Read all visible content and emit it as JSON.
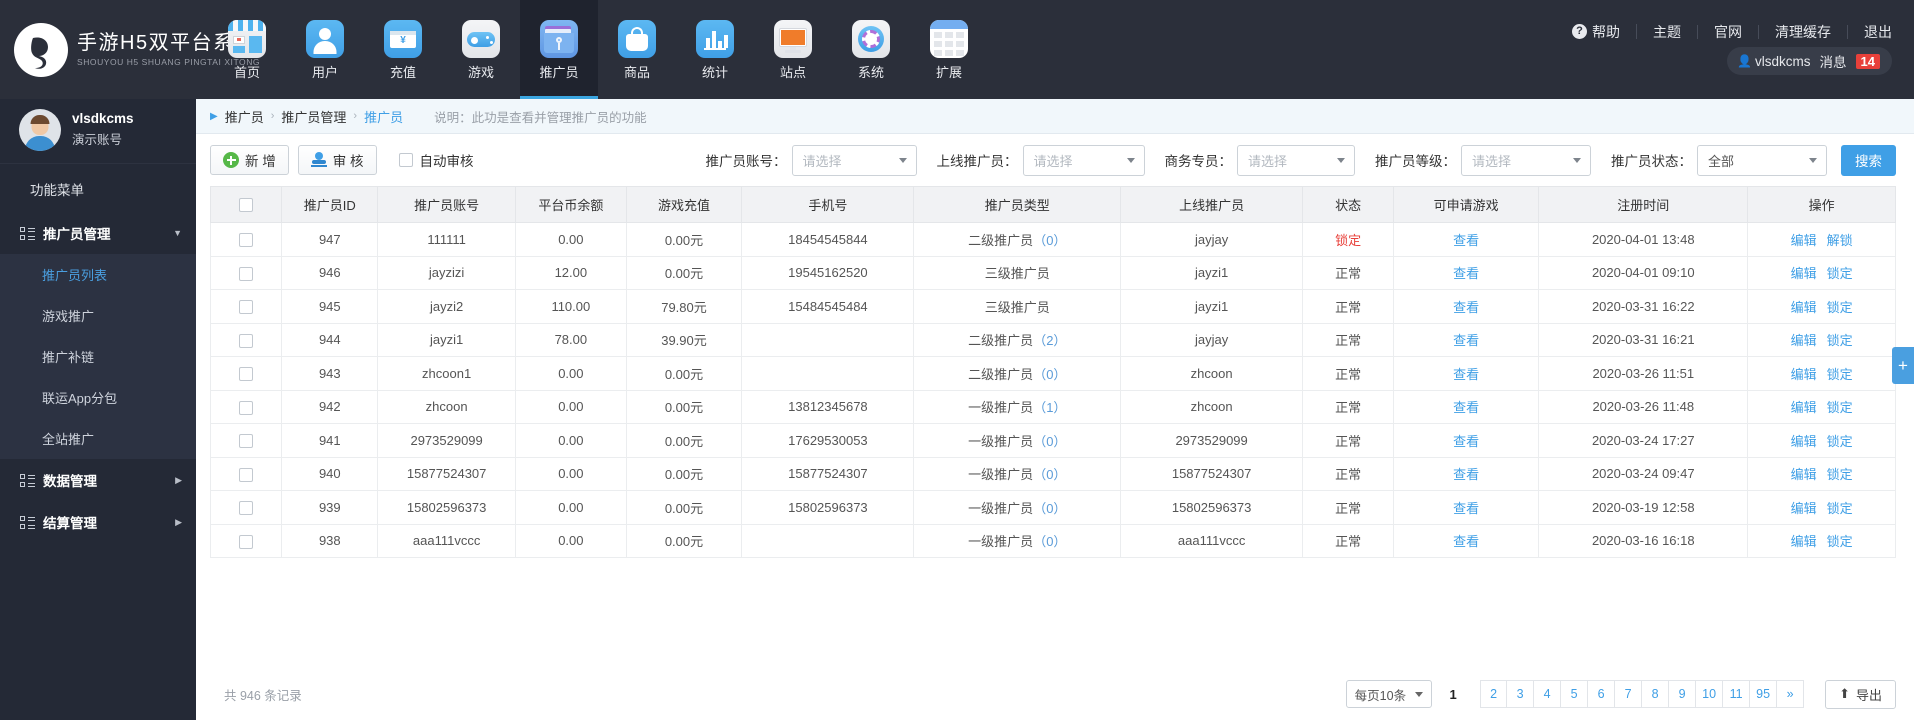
{
  "brand": {
    "cn": "手游H5双平台系统",
    "en": "SHOUYOU H5 SHUANG PINGTAI XITONG"
  },
  "topnav": [
    {
      "label": "首页",
      "icon": "storefront-icon",
      "active": false
    },
    {
      "label": "用户",
      "icon": "user-icon",
      "active": false
    },
    {
      "label": "充值",
      "icon": "payment-card-icon",
      "active": false
    },
    {
      "label": "游戏",
      "icon": "gamepad-icon",
      "active": false
    },
    {
      "label": "推广员",
      "icon": "folder-promo-icon",
      "active": true
    },
    {
      "label": "商品",
      "icon": "shopping-bag-icon",
      "active": false
    },
    {
      "label": "统计",
      "icon": "bar-chart-icon",
      "active": false
    },
    {
      "label": "站点",
      "icon": "monitor-icon",
      "active": false
    },
    {
      "label": "系统",
      "icon": "gear-icon",
      "active": false
    },
    {
      "label": "扩展",
      "icon": "grid-calendar-icon",
      "active": false
    }
  ],
  "topright": {
    "links": [
      "帮助",
      "主题",
      "官网",
      "清理缓存",
      "退出"
    ],
    "username": "vlsdkcms",
    "message_label": "消息",
    "message_count": "14"
  },
  "sidebar": {
    "username": "vlsdkcms",
    "role": "演示账号",
    "menu_title": "功能菜单",
    "groups": [
      {
        "label": "推广员管理",
        "expanded": true,
        "items": [
          {
            "label": "推广员列表",
            "active": true
          },
          {
            "label": "游戏推广",
            "active": false
          },
          {
            "label": "推广补链",
            "active": false
          },
          {
            "label": "联运App分包",
            "active": false
          },
          {
            "label": "全站推广",
            "active": false
          }
        ]
      },
      {
        "label": "数据管理",
        "expanded": false,
        "items": []
      },
      {
        "label": "结算管理",
        "expanded": false,
        "items": []
      }
    ]
  },
  "breadcrumb": {
    "items": [
      "推广员",
      "推广员管理",
      "推广员"
    ],
    "description": "说明：此功是查看并管理推广员的功能"
  },
  "toolbar": {
    "new_label": "新 增",
    "audit_label": "审 核",
    "auto_audit_label": "自动审核",
    "auto_audit_checked": false,
    "search_label": "搜索",
    "filters": [
      {
        "label": "推广员账号：",
        "value": "请选择"
      },
      {
        "label": "上线推广员：",
        "value": "请选择"
      },
      {
        "label": "商务专员：",
        "value": "请选择"
      },
      {
        "label": "推广员等级：",
        "value": "请选择"
      },
      {
        "label": "推广员状态：",
        "value": "全部"
      }
    ]
  },
  "table": {
    "columns": [
      "推广员ID",
      "推广员账号",
      "平台币余额",
      "游戏充值",
      "手机号",
      "推广员类型",
      "上线推广员",
      "状态",
      "可申请游戏",
      "注册时间",
      "操作"
    ],
    "view_label": "查看",
    "rows": [
      {
        "id": "947",
        "account": "111111",
        "balance": "0.00",
        "recharge": "0.00元",
        "phone": "18454545844",
        "type": "二级推广员",
        "count": "0",
        "upline": "jayjay",
        "status": "锁定",
        "status_locked": true,
        "time": "2020-04-01 13:48",
        "ops": [
          "编辑",
          "解锁"
        ]
      },
      {
        "id": "946",
        "account": "jayzizi",
        "balance": "12.00",
        "recharge": "0.00元",
        "phone": "19545162520",
        "type": "三级推广员",
        "count": "",
        "upline": "jayzi1",
        "status": "正常",
        "status_locked": false,
        "time": "2020-04-01 09:10",
        "ops": [
          "编辑",
          "锁定"
        ]
      },
      {
        "id": "945",
        "account": "jayzi2",
        "balance": "110.00",
        "recharge": "79.80元",
        "phone": "15484545484",
        "type": "三级推广员",
        "count": "",
        "upline": "jayzi1",
        "status": "正常",
        "status_locked": false,
        "time": "2020-03-31 16:22",
        "ops": [
          "编辑",
          "锁定"
        ]
      },
      {
        "id": "944",
        "account": "jayzi1",
        "balance": "78.00",
        "recharge": "39.90元",
        "phone": "",
        "type": "二级推广员",
        "count": "2",
        "upline": "jayjay",
        "status": "正常",
        "status_locked": false,
        "time": "2020-03-31 16:21",
        "ops": [
          "编辑",
          "锁定"
        ]
      },
      {
        "id": "943",
        "account": "zhcoon1",
        "balance": "0.00",
        "recharge": "0.00元",
        "phone": "",
        "type": "二级推广员",
        "count": "0",
        "upline": "zhcoon",
        "status": "正常",
        "status_locked": false,
        "time": "2020-03-26 11:51",
        "ops": [
          "编辑",
          "锁定"
        ]
      },
      {
        "id": "942",
        "account": "zhcoon",
        "balance": "0.00",
        "recharge": "0.00元",
        "phone": "13812345678",
        "type": "一级推广员",
        "count": "1",
        "upline": "zhcoon",
        "status": "正常",
        "status_locked": false,
        "time": "2020-03-26 11:48",
        "ops": [
          "编辑",
          "锁定"
        ]
      },
      {
        "id": "941",
        "account": "2973529099",
        "balance": "0.00",
        "recharge": "0.00元",
        "phone": "17629530053",
        "type": "一级推广员",
        "count": "0",
        "upline": "2973529099",
        "status": "正常",
        "status_locked": false,
        "time": "2020-03-24 17:27",
        "ops": [
          "编辑",
          "锁定"
        ]
      },
      {
        "id": "940",
        "account": "15877524307",
        "balance": "0.00",
        "recharge": "0.00元",
        "phone": "15877524307",
        "type": "一级推广员",
        "count": "0",
        "upline": "15877524307",
        "status": "正常",
        "status_locked": false,
        "time": "2020-03-24 09:47",
        "ops": [
          "编辑",
          "锁定"
        ]
      },
      {
        "id": "939",
        "account": "15802596373",
        "balance": "0.00",
        "recharge": "0.00元",
        "phone": "15802596373",
        "type": "一级推广员",
        "count": "0",
        "upline": "15802596373",
        "status": "正常",
        "status_locked": false,
        "time": "2020-03-19 12:58",
        "ops": [
          "编辑",
          "锁定"
        ]
      },
      {
        "id": "938",
        "account": "aaa111vccc",
        "balance": "0.00",
        "recharge": "0.00元",
        "phone": "",
        "type": "一级推广员",
        "count": "0",
        "upline": "aaa111vccc",
        "status": "正常",
        "status_locked": false,
        "time": "2020-03-16 16:18",
        "ops": [
          "编辑",
          "锁定"
        ]
      }
    ]
  },
  "footer": {
    "total_text": "共 946 条记录",
    "per_page": "每页10条",
    "current_page": "1",
    "pages": [
      "2",
      "3",
      "4",
      "5",
      "6",
      "7",
      "8",
      "9",
      "10",
      "11",
      "95"
    ],
    "next_label": "»",
    "export_label": "导出"
  },
  "side_tab_label": "+"
}
